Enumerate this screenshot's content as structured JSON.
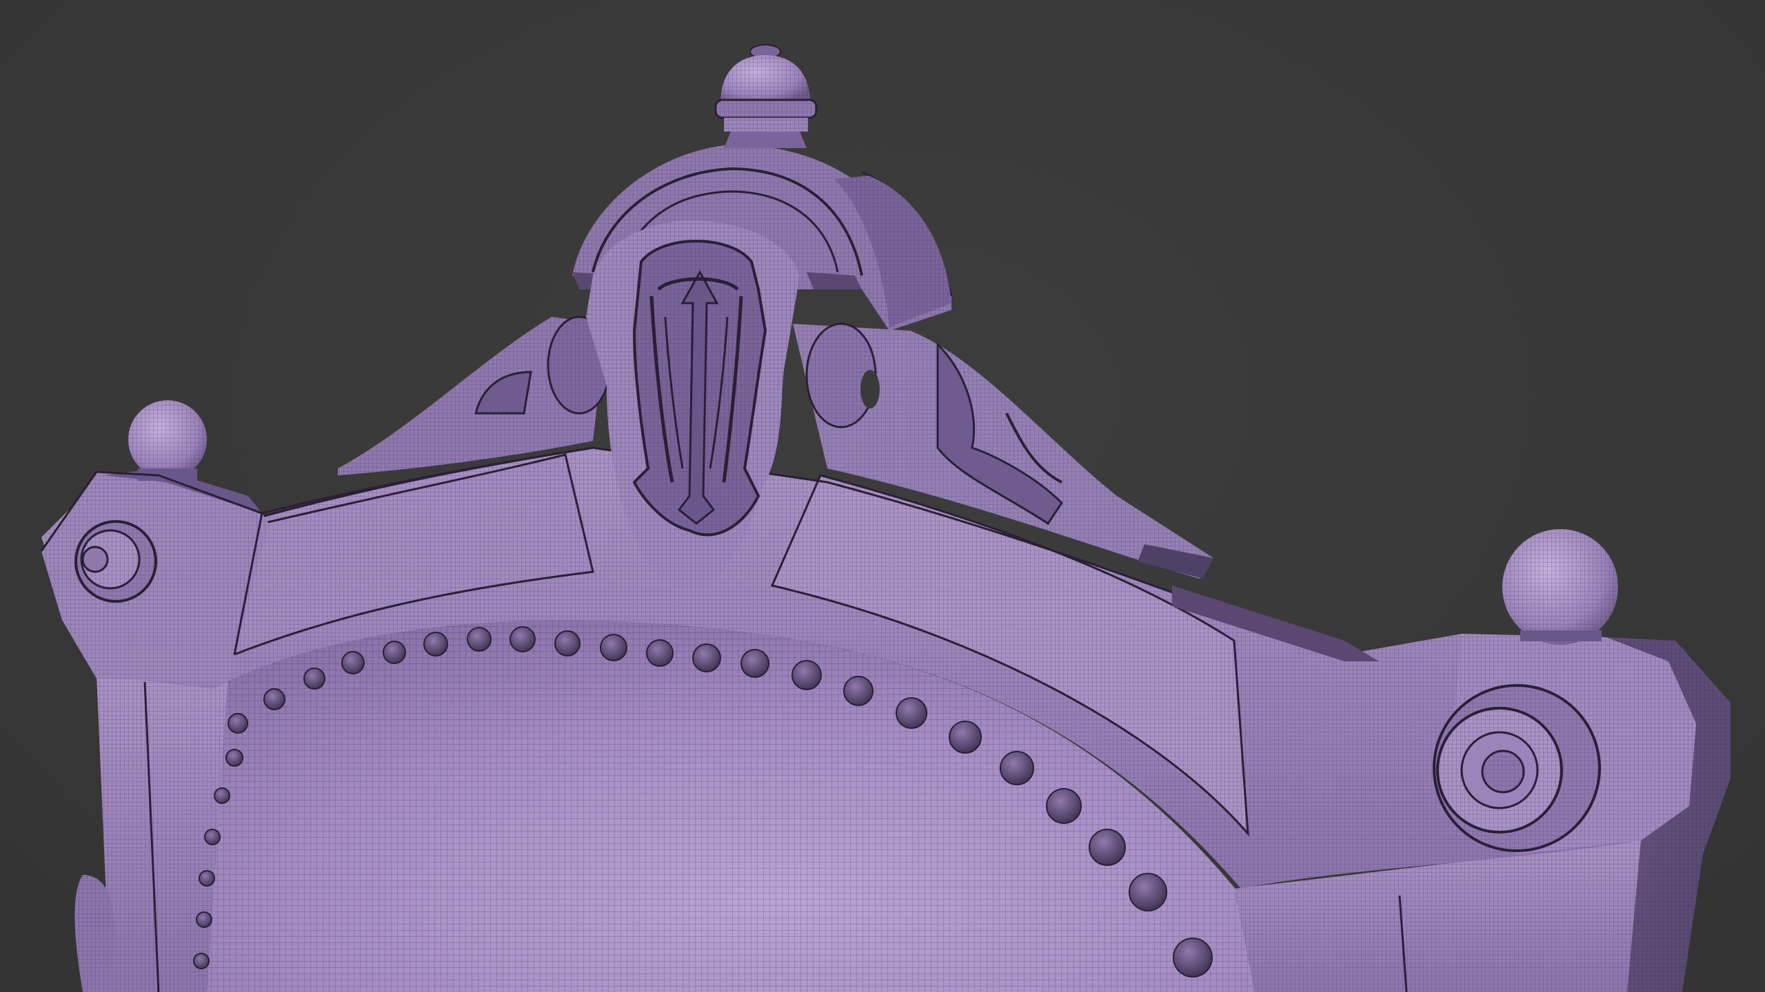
{
  "viewport": {
    "background_color": "#3a3a3a",
    "mesh_color": "#9a82ba",
    "mesh_highlight": "#b8a3d3",
    "mesh_shadow": "#5f4d78",
    "wire_color": "#2a1f36",
    "subject": "wireframe-chair-crest"
  }
}
